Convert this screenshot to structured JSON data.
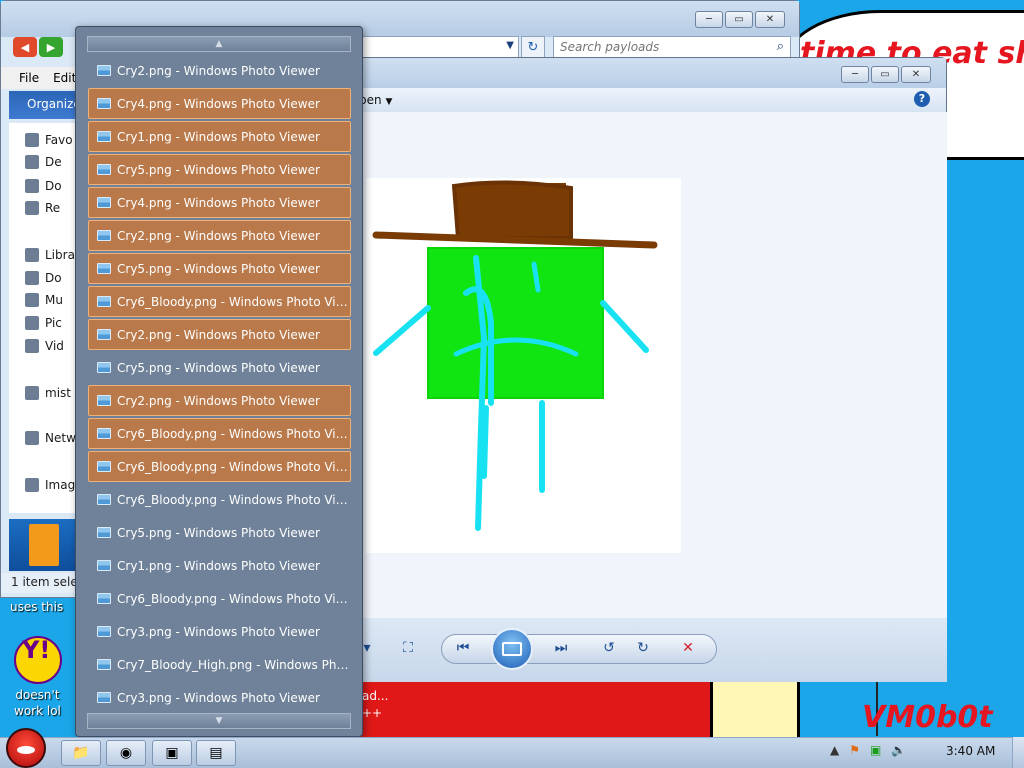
{
  "wallpaper": {
    "meme_text": "time to eat shit\n chew",
    "icon_label_top": "uses this",
    "icon_label_bottom": "doesn't\nwork lol",
    "red_block_text": "ad...\n++",
    "watermark": "VM0b0t"
  },
  "explorer": {
    "search_placeholder": "Search payloads",
    "menu": [
      "File",
      "Edit"
    ],
    "toolbar_label": "Organize",
    "sidebar": [
      {
        "label": "Favo",
        "icon": "star-icon"
      },
      {
        "label": "De",
        "icon": "desktop-icon"
      },
      {
        "label": "Do",
        "icon": "downloads-icon"
      },
      {
        "label": "Re",
        "icon": "recent-places-icon"
      },
      {
        "label": "Libra",
        "icon": "libraries-icon"
      },
      {
        "label": "Do",
        "icon": "documents-icon"
      },
      {
        "label": "Mu",
        "icon": "music-icon"
      },
      {
        "label": "Pic",
        "icon": "pictures-icon"
      },
      {
        "label": "Vid",
        "icon": "videos-icon"
      },
      {
        "label": "mist",
        "icon": "homegroup-icon"
      },
      {
        "label": "Netw",
        "icon": "network-icon"
      },
      {
        "label": "Imag",
        "icon": "image-icon"
      }
    ],
    "status": "1 item sele"
  },
  "photoviewer": {
    "open_label": "pen",
    "help": "?"
  },
  "window_list": {
    "items": [
      {
        "label": "Cry2.png - Windows Photo Viewer",
        "highlighted": false
      },
      {
        "label": "Cry4.png - Windows Photo Viewer",
        "highlighted": true
      },
      {
        "label": "Cry1.png - Windows Photo Viewer",
        "highlighted": true
      },
      {
        "label": "Cry5.png - Windows Photo Viewer",
        "highlighted": true
      },
      {
        "label": "Cry4.png - Windows Photo Viewer",
        "highlighted": true
      },
      {
        "label": "Cry2.png - Windows Photo Viewer",
        "highlighted": true
      },
      {
        "label": "Cry5.png - Windows Photo Viewer",
        "highlighted": true
      },
      {
        "label": "Cry6_Bloody.png - Windows Photo Vie...",
        "highlighted": true
      },
      {
        "label": "Cry2.png - Windows Photo Viewer",
        "highlighted": true
      },
      {
        "label": "Cry5.png - Windows Photo Viewer",
        "highlighted": false
      },
      {
        "label": "Cry2.png - Windows Photo Viewer",
        "highlighted": true
      },
      {
        "label": "Cry6_Bloody.png - Windows Photo Vie...",
        "highlighted": true
      },
      {
        "label": "Cry6_Bloody.png - Windows Photo Vie...",
        "highlighted": true
      },
      {
        "label": "Cry6_Bloody.png - Windows Photo Vie...",
        "highlighted": false
      },
      {
        "label": "Cry5.png - Windows Photo Viewer",
        "highlighted": false
      },
      {
        "label": "Cry1.png - Windows Photo Viewer",
        "highlighted": false
      },
      {
        "label": "Cry6_Bloody.png - Windows Photo Vie...",
        "highlighted": false
      },
      {
        "label": "Cry3.png - Windows Photo Viewer",
        "highlighted": false
      },
      {
        "label": "Cry7_Bloody_High.png - Windows Phot...",
        "highlighted": false
      },
      {
        "label": "Cry3.png - Windows Photo Viewer",
        "highlighted": false
      }
    ]
  },
  "taskbar": {
    "clock": "3:40 AM",
    "buttons": [
      {
        "name": "explorer-taskbar-button",
        "icon": "folder-icon",
        "glyph": "📁"
      },
      {
        "name": "chrome-taskbar-button",
        "icon": "chrome-icon",
        "glyph": "◉"
      },
      {
        "name": "cmd-taskbar-button",
        "icon": "cmd-icon",
        "glyph": "▣"
      },
      {
        "name": "photoviewer-taskbar-button",
        "icon": "photo-viewer-icon",
        "glyph": "▤"
      }
    ]
  },
  "colors": {
    "highlight": "#b9794a",
    "list_bg": "#6f8299",
    "wallpaper": "#1aa6e8"
  }
}
